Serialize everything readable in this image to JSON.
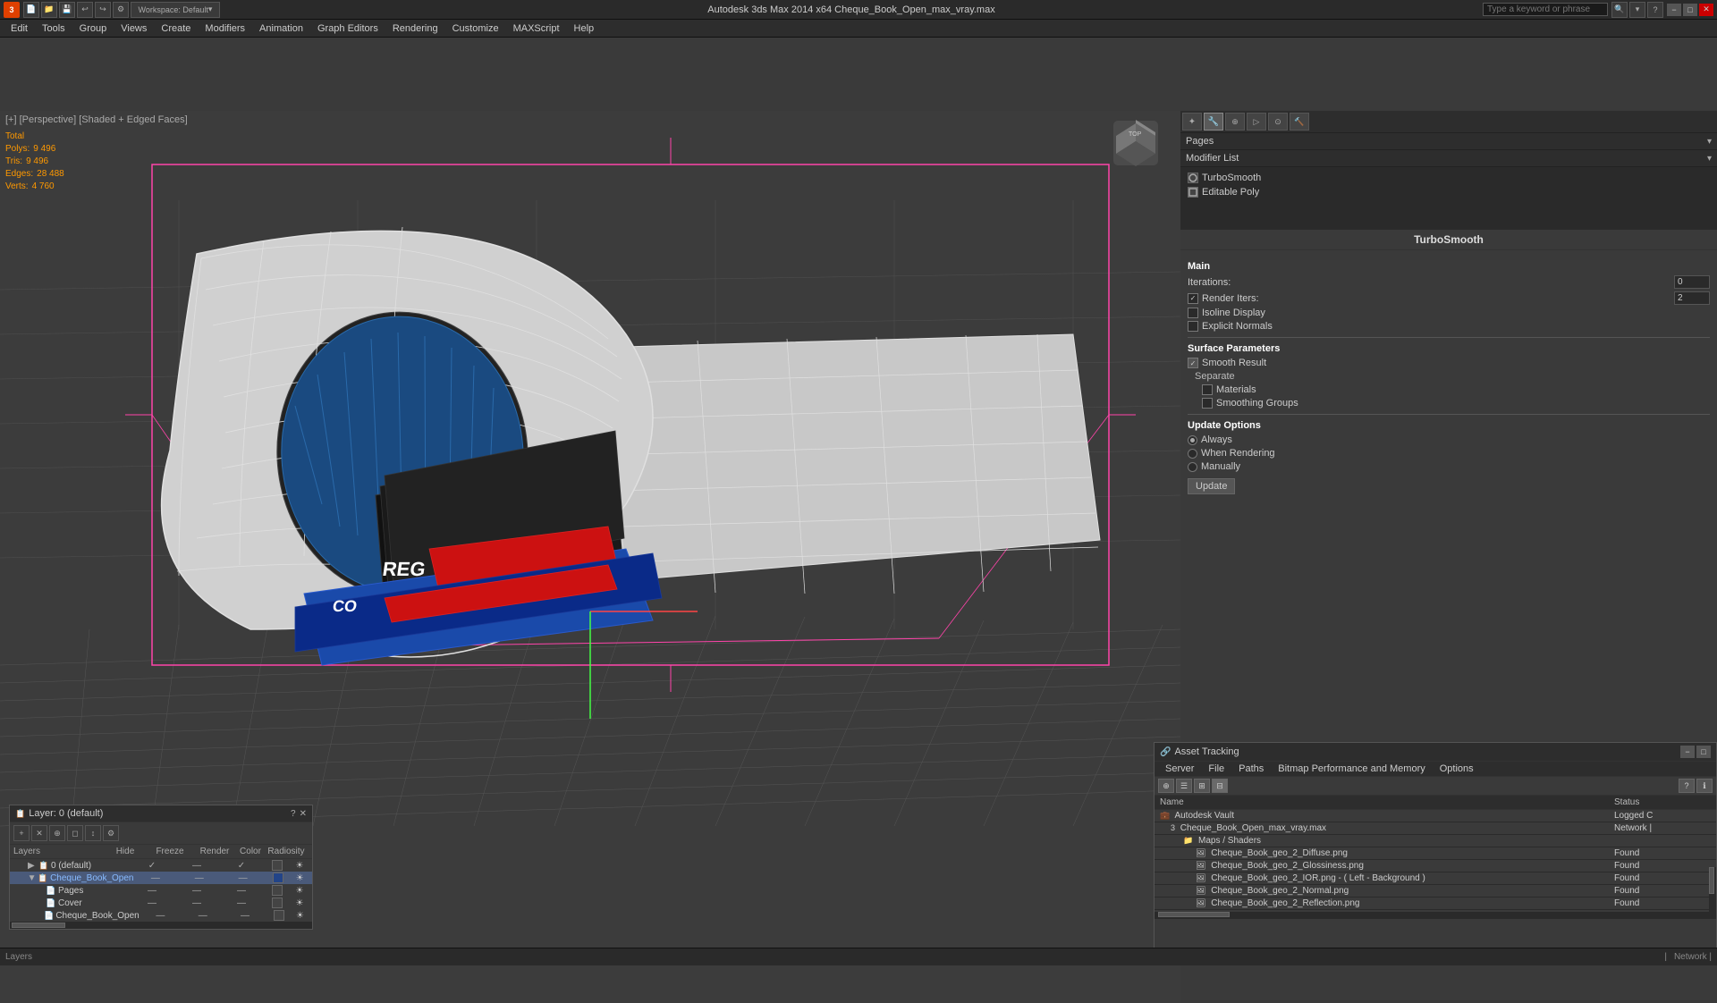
{
  "window": {
    "title": "Autodesk 3ds Max 2014 x64     Cheque_Book_Open_max_vray.max",
    "min_label": "−",
    "max_label": "□",
    "close_label": "✕"
  },
  "topbar": {
    "logo": "3",
    "workspace_label": "Workspace: Default",
    "search_placeholder": "Type a keyword or phrase"
  },
  "menubar": {
    "items": [
      "Edit",
      "Tools",
      "Group",
      "Views",
      "Create",
      "Modifiers",
      "Animation",
      "Graph Editors",
      "Rendering",
      "Customize",
      "MAXScript",
      "Help"
    ]
  },
  "viewport": {
    "label": "[+] [Perspective] [Shaded + Edged Faces]",
    "stats": {
      "polys_label": "Polys:",
      "polys_value": "9 496",
      "tris_label": "Tris:",
      "tris_value": "9 496",
      "edges_label": "Edges:",
      "edges_value": "28 488",
      "verts_label": "Verts:",
      "verts_value": "4 760"
    }
  },
  "modifier_panel": {
    "title": "Modifier List",
    "dropdown_arrow": "▾",
    "modifiers": [
      {
        "name": "TurboSmooth",
        "checked": true
      },
      {
        "name": "Editable Poly",
        "checked": true
      }
    ],
    "turbosmooth": {
      "section_title": "TurboSmooth",
      "main_label": "Main",
      "iterations_label": "Iterations:",
      "iterations_value": "0",
      "render_iters_label": "Render Iters:",
      "render_iters_value": "2",
      "isoline_display_label": "Isoline Display",
      "explicit_normals_label": "Explicit Normals",
      "surface_params_label": "Surface Parameters",
      "smooth_result_label": "Smooth Result",
      "separate_label": "Separate",
      "materials_label": "Materials",
      "smoothing_groups_label": "Smoothing Groups",
      "update_options_label": "Update Options",
      "always_label": "Always",
      "when_rendering_label": "When Rendering",
      "manually_label": "Manually",
      "update_btn": "Update"
    }
  },
  "pages_panel": {
    "title": "Pages",
    "dropdown_arrow": "▾"
  },
  "layers_panel": {
    "title": "Layer: 0 (default)",
    "help_label": "?",
    "close_label": "✕",
    "columns": {
      "name": "Layers",
      "hide": "Hide",
      "freeze": "Freeze",
      "render": "Render",
      "color": "Color",
      "radiosity": "Radiosity"
    },
    "rows": [
      {
        "indent": 0,
        "expand": "",
        "name": "0 (default)",
        "check_hide": "✓",
        "check_freeze": "—",
        "check_render": "✓",
        "color": "#444",
        "radiosity": "☀"
      },
      {
        "indent": 1,
        "expand": "▼",
        "name": "Cheque_Book_Open",
        "check_hide": "—",
        "check_freeze": "—",
        "check_render": "—",
        "color": "#224488",
        "radiosity": "☀",
        "selected": true
      },
      {
        "indent": 2,
        "expand": "",
        "name": "Pages",
        "check_hide": "—",
        "check_freeze": "—",
        "check_render": "—",
        "color": "#444",
        "radiosity": "☀"
      },
      {
        "indent": 2,
        "expand": "",
        "name": "Cover",
        "check_hide": "—",
        "check_freeze": "—",
        "check_render": "—",
        "color": "#444",
        "radiosity": "☀"
      },
      {
        "indent": 2,
        "expand": "",
        "name": "Cheque_Book_Open",
        "check_hide": "—",
        "check_freeze": "—",
        "check_render": "—",
        "color": "#444",
        "radiosity": "☀"
      }
    ]
  },
  "asset_panel": {
    "title": "Asset Tracking",
    "min_label": "−",
    "restore_label": "□",
    "menu": [
      "Server",
      "File",
      "Paths",
      "Bitmap Performance and Memory",
      "Options"
    ],
    "columns": {
      "name": "Name",
      "status": "Status"
    },
    "rows": [
      {
        "icon": "💼",
        "indent": 0,
        "name": "Autodesk Vault",
        "status": "Logged C",
        "status_class": "status-loggedc"
      },
      {
        "icon": "📄",
        "indent": 1,
        "name": "Cheque_Book_Open_max_vray.max",
        "status": "Network |",
        "status_class": "status-network"
      },
      {
        "icon": "📁",
        "indent": 2,
        "name": "Maps / Shaders",
        "status": "",
        "status_class": ""
      },
      {
        "icon": "🖼",
        "indent": 3,
        "name": "Cheque_Book_geo_2_Diffuse.png",
        "status": "Found",
        "status_class": "status-found"
      },
      {
        "icon": "🖼",
        "indent": 3,
        "name": "Cheque_Book_geo_2_Glossiness.png",
        "status": "Found",
        "status_class": "status-found"
      },
      {
        "icon": "🖼",
        "indent": 3,
        "name": "Cheque_Book_geo_2_IOR.png - ( Left - Background )",
        "status": "Found",
        "status_class": "status-found"
      },
      {
        "icon": "🖼",
        "indent": 3,
        "name": "Cheque_Book_geo_2_Normal.png",
        "status": "Found",
        "status_class": "status-found"
      },
      {
        "icon": "🖼",
        "indent": 3,
        "name": "Cheque_Book_geo_2_Reflection.png",
        "status": "Found",
        "status_class": "status-found"
      }
    ]
  },
  "statusbar": {
    "layers_label": "Layers",
    "network_label": "Network |"
  }
}
